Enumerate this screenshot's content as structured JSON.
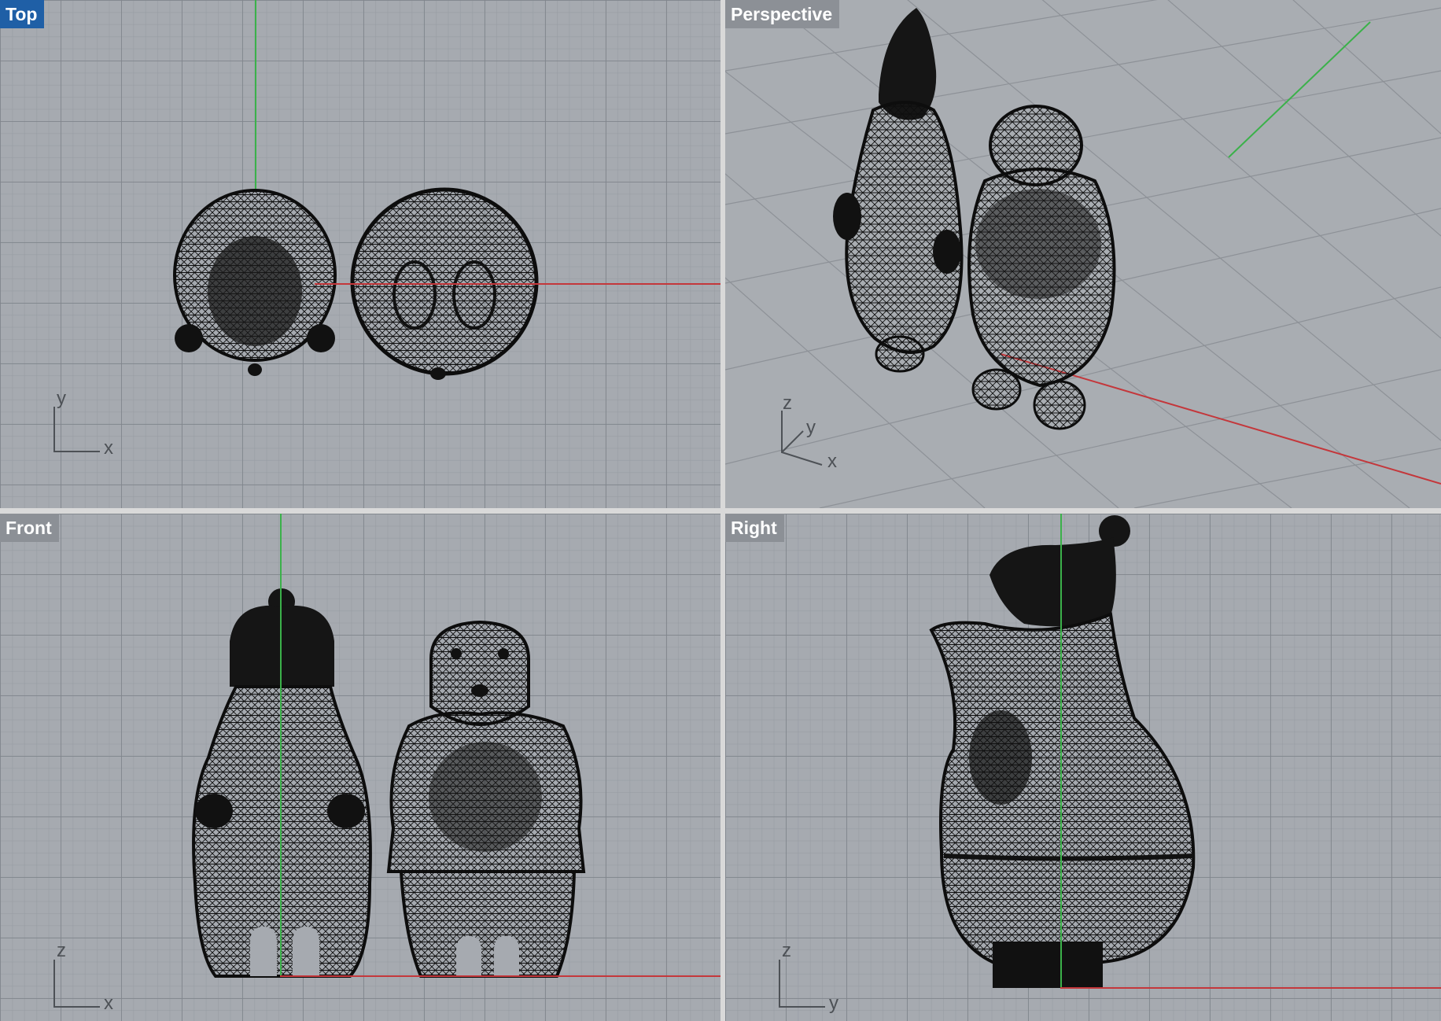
{
  "viewports": {
    "top": {
      "label": "Top",
      "axis_labels": {
        "horizontal": "x",
        "vertical": "y"
      }
    },
    "perspective": {
      "label": "Perspective",
      "axis_labels": {
        "x": "x",
        "y": "y",
        "z": "z"
      }
    },
    "front": {
      "label": "Front",
      "axis_labels": {
        "horizontal": "x",
        "vertical": "z"
      }
    },
    "right": {
      "label": "Right",
      "axis_labels": {
        "horizontal": "y",
        "vertical": "z"
      }
    }
  },
  "active_viewport": "Top",
  "colors": {
    "viewport_background": "#a6aab0",
    "grid_line": "#80858c",
    "x_axis": "#c4373b",
    "y_axis": "#3bb14a",
    "active_label": "#1f5fa6",
    "inactive_label": "#8c9096",
    "mesh": "#0d0d0d"
  },
  "display_mode": "wireframe"
}
